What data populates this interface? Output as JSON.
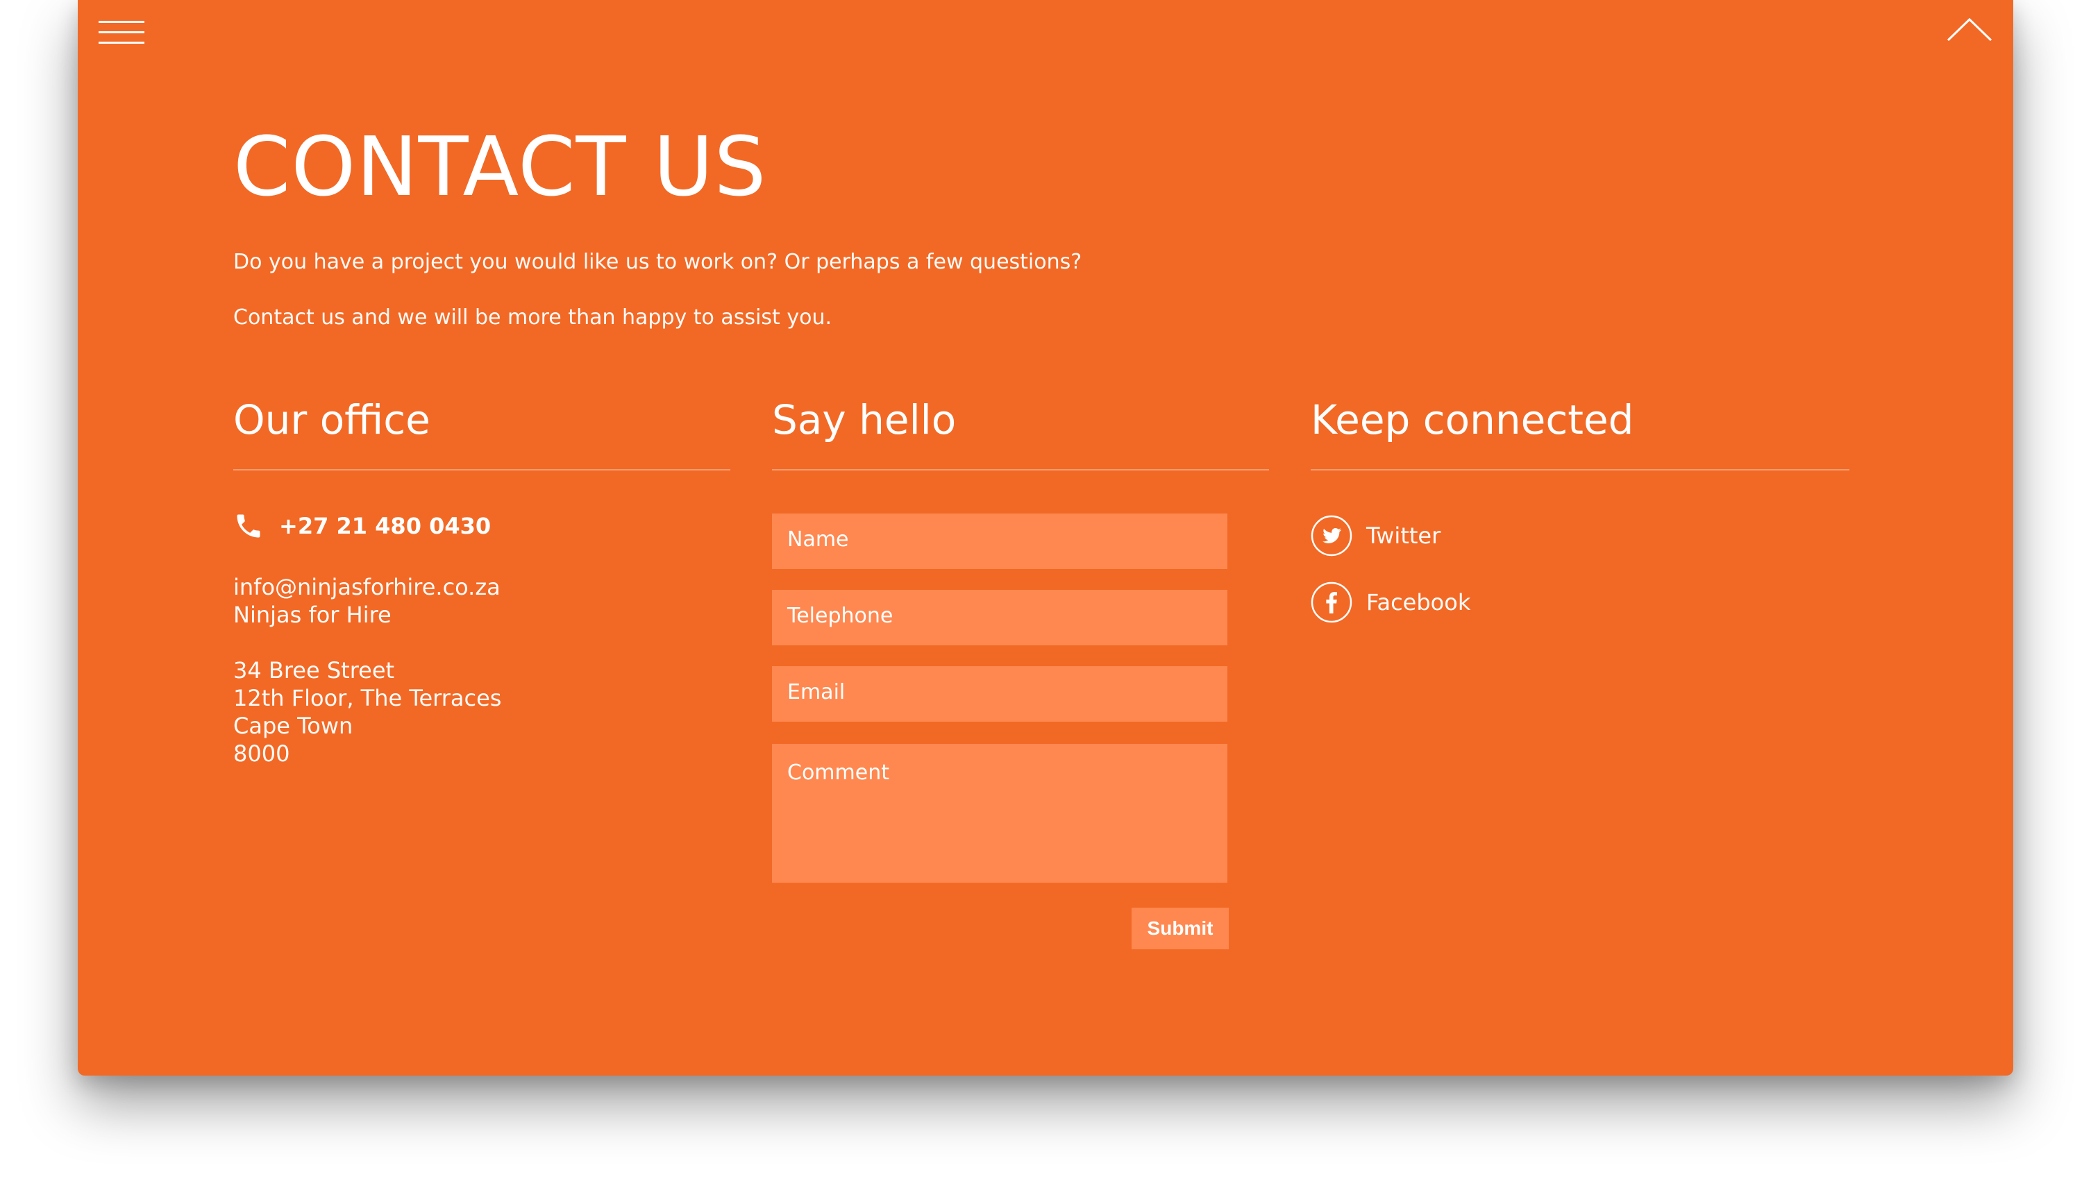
{
  "nav": {
    "menu_icon": "hamburger-menu-icon",
    "scroll_top_icon": "chevron-up-icon"
  },
  "page": {
    "title": "CONTACT US",
    "intro_1": "Do you have a project you would like us to work on? Or perhaps a few questions?",
    "intro_2": "Contact us and we will be more than happy to assist you.",
    "background_color": "#f26925",
    "field_color": "#ff8850"
  },
  "office": {
    "heading": "Our office",
    "phone_icon": "phone-icon",
    "phone": "+27 21 480 0430",
    "email": "info@ninjasforhire.co.za",
    "company": "Ninjas for Hire",
    "address_1": "34 Bree Street",
    "address_2": "12th Floor, The Terraces",
    "city": "Cape Town",
    "postal_code": "8000"
  },
  "form": {
    "heading": "Say hello",
    "name_placeholder": "Name",
    "telephone_placeholder": "Telephone",
    "email_placeholder": "Email",
    "comment_placeholder": "Comment",
    "submit_label": "Submit"
  },
  "social": {
    "heading": "Keep connected",
    "items": [
      {
        "label": "Twitter",
        "icon": "twitter-icon"
      },
      {
        "label": "Facebook",
        "icon": "facebook-icon"
      }
    ]
  }
}
